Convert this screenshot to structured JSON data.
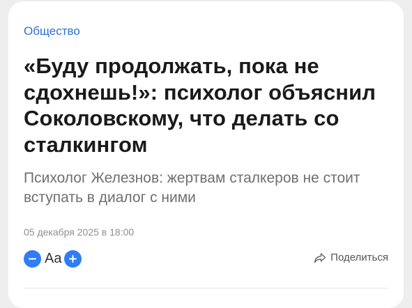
{
  "article": {
    "rubric": "Общество",
    "headline": "«Буду продолжать, пока не сдохнешь!»: психолог объяснил Соколовскому, что делать со сталкингом",
    "lead": "Психолог Железнов: жертвам сталкеров не стоит вступать в диалог с ними",
    "date": "05 декабря 2025 в 18:00"
  },
  "toolbar": {
    "font_label": "Aa",
    "decrease_icon": "minus-icon",
    "increase_icon": "plus-icon",
    "share_icon": "share-arrow-icon",
    "share_label": "Поделиться"
  },
  "colors": {
    "accent": "#2f7cf6",
    "rubric": "#2a6fdb",
    "headline": "#1a1a1a",
    "lead": "#6f6f6f",
    "meta": "#8e8e8e",
    "background": "#eeeeee",
    "card": "#ffffff"
  }
}
